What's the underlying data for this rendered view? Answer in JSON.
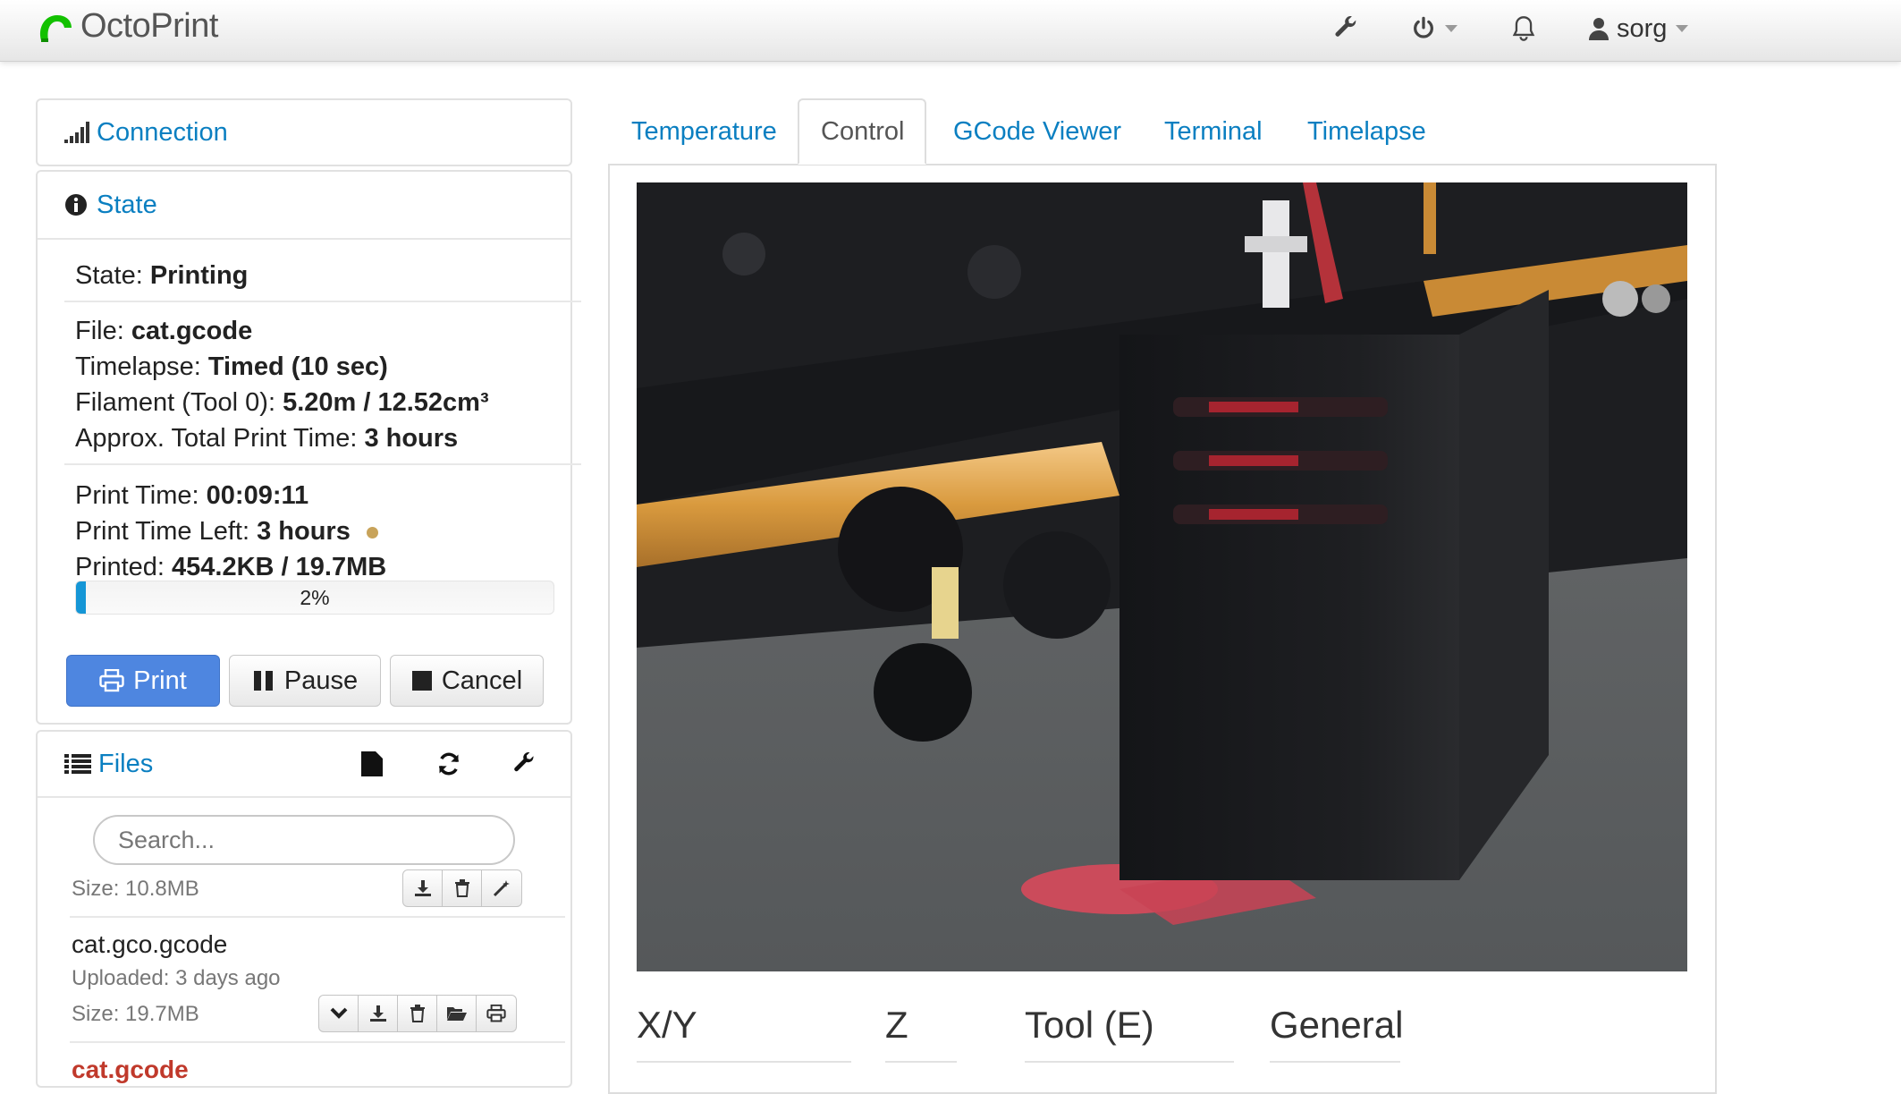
{
  "app": {
    "brand": "OctoPrint",
    "user": "sorg"
  },
  "icons": {
    "logo": "octoprint-logo-icon",
    "settings": "wrench-icon",
    "system": "power-icon",
    "notifications": "bell-icon",
    "user": "user-icon"
  },
  "connection": {
    "title": "Connection"
  },
  "state": {
    "title": "State",
    "state_label": "State: ",
    "state_value": "Printing",
    "file_label": "File: ",
    "file_value": "cat.gcode",
    "timelapse_label": "Timelapse: ",
    "timelapse_value": "Timed (10 sec)",
    "filament_label": "Filament (Tool 0): ",
    "filament_value": "5.20m / 12.52cm³",
    "approx_label": "Approx. Total Print Time: ",
    "approx_value": "3 hours",
    "print_time_label": "Print Time: ",
    "print_time_value": "00:09:11",
    "time_left_label": "Print Time Left: ",
    "time_left_value": "3 hours",
    "printed_label": "Printed: ",
    "printed_value": "454.2KB / 19.7MB",
    "progress_text": "2%",
    "progress_fraction": 0.02,
    "estimate_dot_color": "#c8a35a"
  },
  "buttons": {
    "print": "Print",
    "pause": "Pause",
    "cancel": "Cancel"
  },
  "files": {
    "title": "Files",
    "search_placeholder": "Search...",
    "items": [
      {
        "size": "Size: 10.8MB"
      },
      {
        "name": "cat.gco.gcode",
        "uploaded": "Uploaded: 3 days ago",
        "size": "Size: 19.7MB"
      },
      {
        "name": "cat.gcode"
      }
    ]
  },
  "tabs": [
    "Temperature",
    "Control",
    "GCode Viewer",
    "Terminal",
    "Timelapse"
  ],
  "control": {
    "sections": [
      "X/Y",
      "Z",
      "Tool (E)",
      "General"
    ]
  },
  "colors": {
    "link": "#0a7fc1",
    "primary": "#4e86e0",
    "progress": "#1596d6",
    "active_file": "#c0392b"
  }
}
